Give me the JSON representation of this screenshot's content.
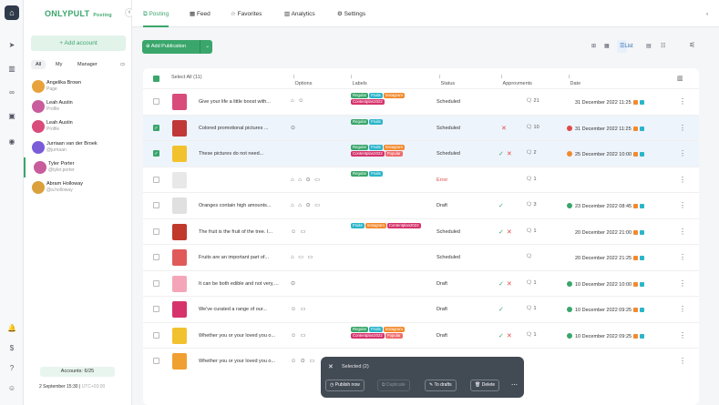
{
  "app": {
    "brand": "ONLYPULT",
    "brand_sub": "Posting"
  },
  "nav": {
    "tabs": [
      {
        "label": "Posting",
        "icon": "posting-icon"
      },
      {
        "label": "Feed",
        "icon": "feed-icon"
      },
      {
        "label": "Favorites",
        "icon": "star-icon"
      },
      {
        "label": "Analytics",
        "icon": "analytics-icon"
      },
      {
        "label": "Settings",
        "icon": "settings-icon"
      }
    ]
  },
  "sidebar": {
    "add_account": "+ Add account",
    "filters": [
      "All",
      "My",
      "Manager"
    ],
    "accounts": [
      {
        "name": "Angelika Brown",
        "handle": "Page"
      },
      {
        "name": "Leah Austin",
        "handle": "Profile"
      },
      {
        "name": "Leah Austin",
        "handle": "Profile"
      },
      {
        "name": "Jurriaan van der Broek",
        "handle": "@jurriaan"
      },
      {
        "name": "Tyler Porter",
        "handle": "@tyler.porter"
      },
      {
        "name": "Abram Holloway",
        "handle": "@a.holloway"
      }
    ],
    "accounts_count": "Accounts: 6/25",
    "datetime": "2 September 15:30",
    "timezone": "UTC+03:00"
  },
  "toolbar": {
    "add_publication": "Add Publication",
    "view_list": "List"
  },
  "table": {
    "columns": {
      "select_all": "Select All (11)",
      "options": "Options",
      "labels": "Labels",
      "status": "Status",
      "approvments": "Approvments",
      "date": "Date"
    },
    "rows": [
      {
        "text": "Give your life a little boost with...",
        "labels": [
          "Regular",
          "Fruits",
          "Instagram",
          "Contentplan2022"
        ],
        "status": "Scheduled",
        "comments": "21",
        "date": "31 December 2022 11:25",
        "selected": false
      },
      {
        "text": "Colored promotional pictures ...",
        "labels": [
          "Regular",
          "Fruits"
        ],
        "status": "Scheduled",
        "comments": "10",
        "date": "31 December 2022 11:25",
        "selected": true
      },
      {
        "text": "These pictures do not need...",
        "labels": [
          "Regular",
          "Fruits",
          "Instagram",
          "Contentplan2022",
          "Popular"
        ],
        "status": "Scheduled",
        "comments": "2",
        "date": "25 December 2022 10:00",
        "selected": true
      },
      {
        "text": "",
        "labels": [
          "Regular",
          "Fruits"
        ],
        "status": "Error",
        "comments": "1",
        "date": "",
        "selected": false
      },
      {
        "text": "Oranges contain high amounts...",
        "labels": [],
        "status": "Draft",
        "comments": "3",
        "date": "23 December 2022 08:45",
        "selected": false
      },
      {
        "text": "The fruit is the fruit of the tree. I...",
        "labels": [
          "Fruits",
          "Instagram",
          "Contentplan2022"
        ],
        "status": "Scheduled",
        "comments": "1",
        "date": "20 December 2022 21:00",
        "selected": false
      },
      {
        "text": "Fruits are an important part of...",
        "labels": [],
        "status": "Scheduled",
        "comments": "",
        "date": "20 December 2022 21:25",
        "selected": false
      },
      {
        "text": "It can be both edible and not very, for...",
        "labels": [],
        "status": "Draft",
        "comments": "1",
        "date": "10 December 2022 10:00",
        "selected": false
      },
      {
        "text": "We've curated a range of our...",
        "labels": [],
        "status": "Draft",
        "comments": "1",
        "date": "10 December 2022 09:25",
        "selected": false
      },
      {
        "text": "Whether you or your loved you o...",
        "labels": [
          "Regular",
          "Fruits",
          "Instagram",
          "Contentplan2022",
          "Popular"
        ],
        "status": "Draft",
        "comments": "1",
        "date": "10 December 2022 09:25",
        "selected": false
      },
      {
        "text": "Whether you or your loved you o...",
        "labels": [],
        "status": "",
        "comments": "",
        "date": "",
        "selected": false
      }
    ]
  },
  "selection": {
    "title": "Selected (2)",
    "publish": "Publish now",
    "duplicate": "Duplicate",
    "drafts": "To drafts",
    "delete": "Delete"
  },
  "colors": {
    "accent": "#3aa66b",
    "label_regular": "#3aa66b",
    "label_fruits": "#2bb5c9",
    "label_instagram": "#f28a2e",
    "label_contentplan": "#d6336c",
    "label_popular": "#f06b6b",
    "error": "#e04848"
  }
}
